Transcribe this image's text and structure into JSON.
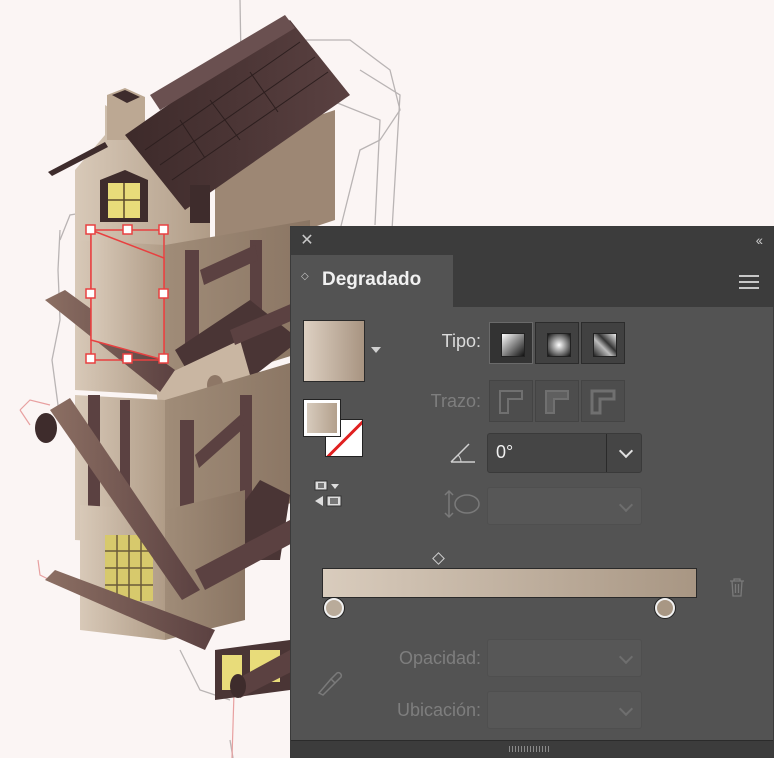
{
  "panel": {
    "title": "Degradado",
    "close_icon": "close-icon",
    "collapse_glyph": "‹‹",
    "menu_icon": "hamburger-menu-icon"
  },
  "type_row": {
    "label": "Tipo:",
    "options": [
      "linear-gradient-icon",
      "radial-gradient-icon",
      "freeform-gradient-icon"
    ],
    "selected": "linear-gradient-icon"
  },
  "stroke_row": {
    "label": "Trazo:",
    "options": [
      "stroke-within-icon",
      "stroke-along-icon",
      "stroke-across-icon"
    ]
  },
  "angle": {
    "value": "0°",
    "icon": "angle-icon"
  },
  "aspect_ratio": {
    "value": "",
    "icon": "aspect-ratio-icon"
  },
  "gradient": {
    "start_color": "#d9ccbd",
    "end_color": "#a89683",
    "stops": [
      {
        "position": 0,
        "color": "#b9ab9a"
      },
      {
        "position": 1,
        "color": "#a89784"
      }
    ],
    "midpoint": 0.23
  },
  "opacity": {
    "label": "Opacidad:",
    "value": ""
  },
  "location": {
    "label": "Ubicación:",
    "value": ""
  },
  "colors": {
    "panel_bg": "#535353",
    "titlebar_bg": "#3c3c3c",
    "selection": "#e84040",
    "wall": "#b8a48f",
    "roof": "#4a3535",
    "timber": "#5b4140",
    "window_light": "#e8dc7a"
  }
}
